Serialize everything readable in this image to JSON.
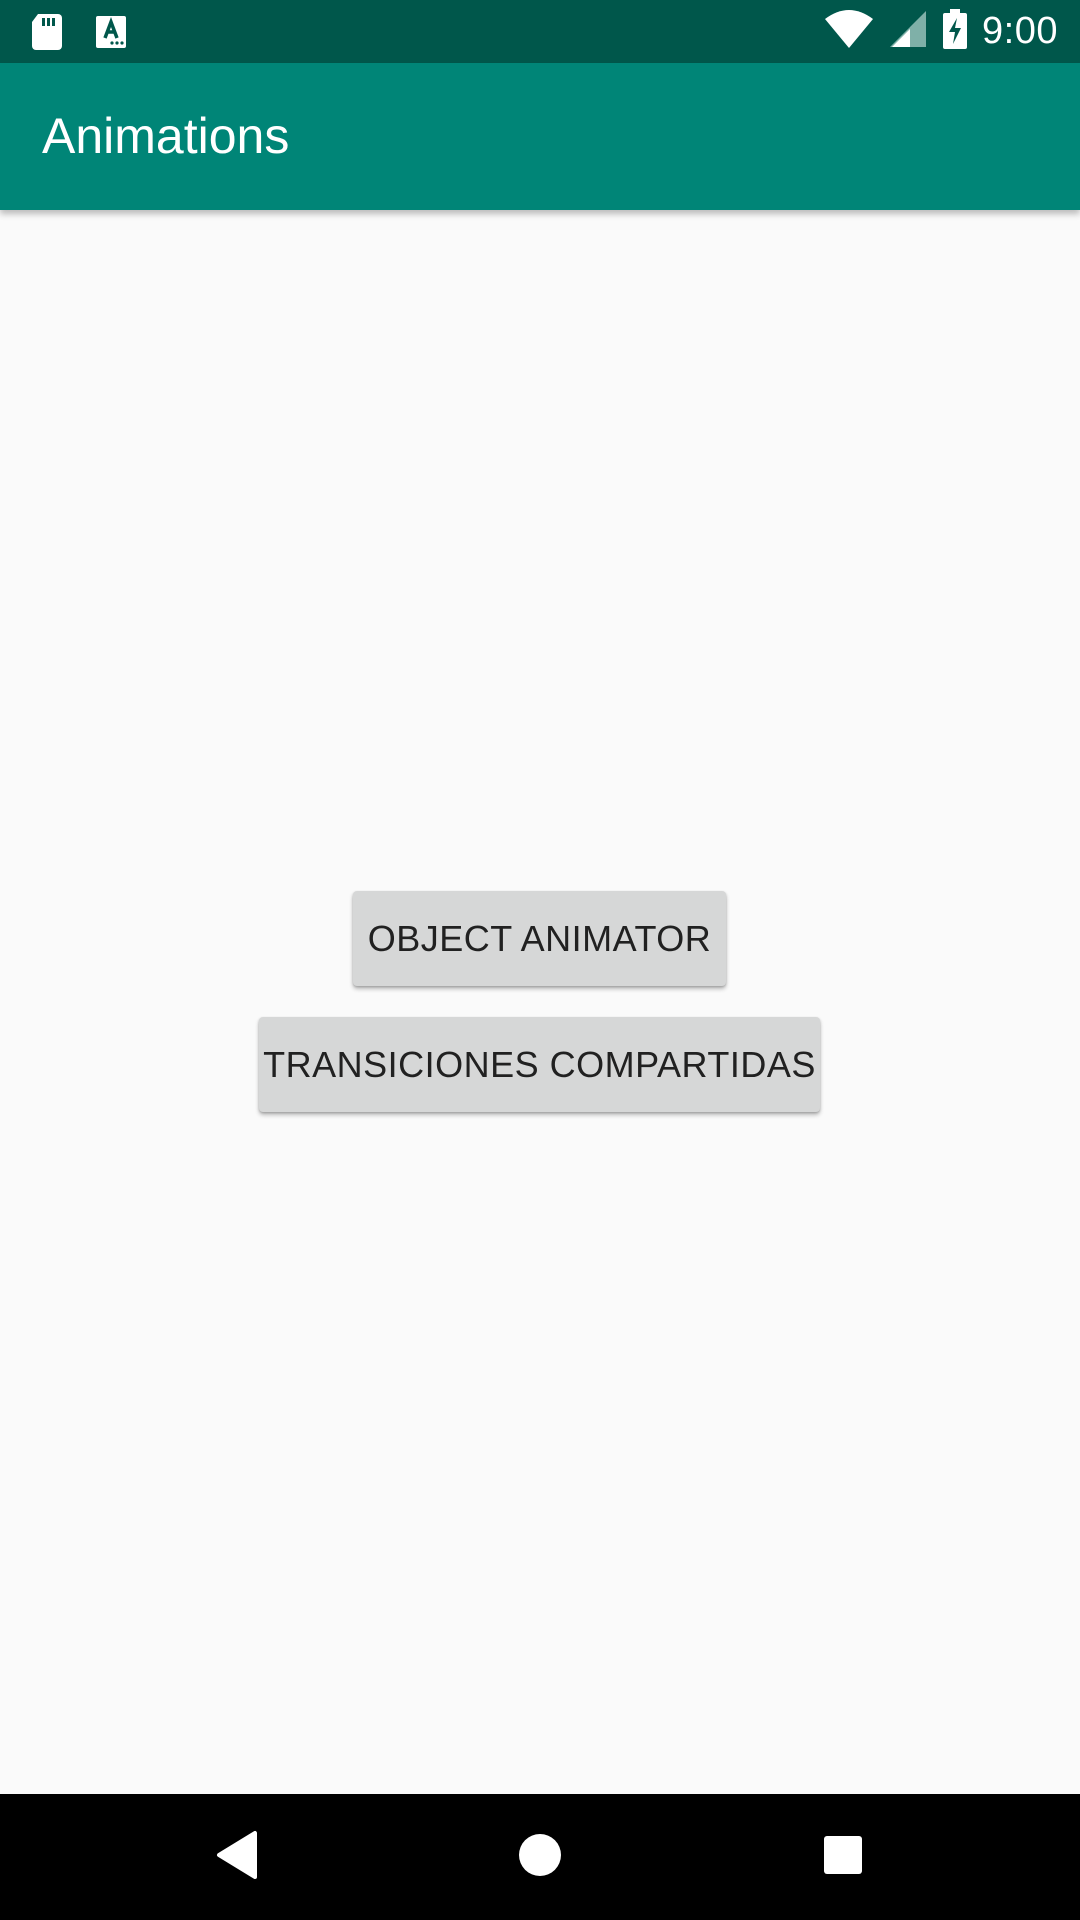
{
  "status_bar": {
    "time": "9:00",
    "icons": [
      "sd-card-icon",
      "font-download-icon",
      "wifi-icon",
      "cell-signal-icon",
      "battery-charging-icon"
    ],
    "background": "#00574b"
  },
  "app_bar": {
    "title": "Animations",
    "background": "#008577"
  },
  "main": {
    "buttons": [
      {
        "label": "OBJECT ANIMATOR"
      },
      {
        "label": "TRANSICIONES COMPARTIDAS"
      }
    ],
    "button_background": "#d6d7d7",
    "background": "#fafafa"
  },
  "nav_bar": {
    "buttons": [
      "back-icon",
      "home-icon",
      "recents-icon"
    ],
    "background": "#000000"
  }
}
